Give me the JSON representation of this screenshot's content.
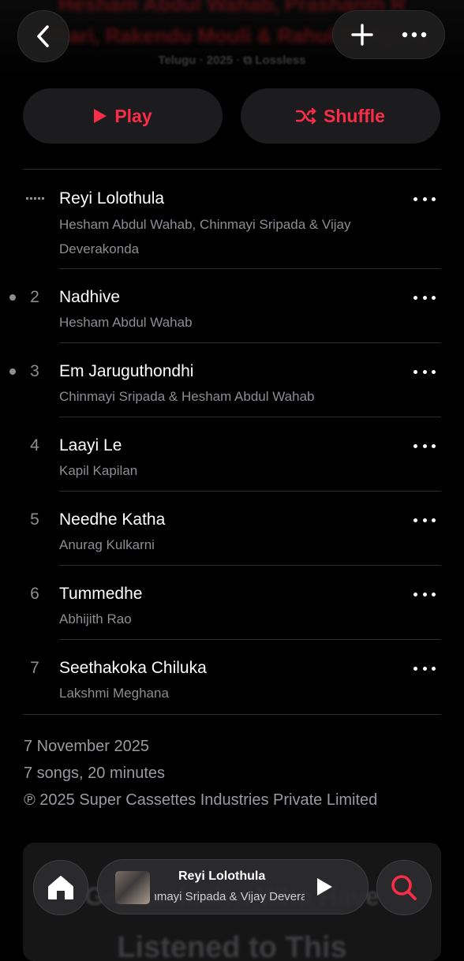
{
  "header": {
    "artists_line1": "Hesham Abdul Wahab, Prashanth R",
    "artists_line2": "Vihari, Rakendu Mouli & Rahul Sipligunj",
    "meta": "Telugu · 2025 · ⧉ Lossless",
    "back_icon": "chevron-left-icon",
    "add_icon": "plus-icon",
    "more_icon": "ellipsis-icon"
  },
  "actions": {
    "play_label": "Play",
    "shuffle_label": "Shuffle",
    "accent_color": "#fa2d48"
  },
  "tracks": [
    {
      "number": "",
      "title": "Reyi Lolothula",
      "artist": "Hesham Abdul Wahab, Chinmayi Sripada & Vijay Deverakonda",
      "playing": true,
      "downloaded": false
    },
    {
      "number": "2",
      "title": "Nadhive",
      "artist": "Hesham Abdul Wahab",
      "playing": false,
      "downloaded": true
    },
    {
      "number": "3",
      "title": "Em Jaruguthondhi",
      "artist": "Chinmayi Sripada & Hesham Abdul Wahab",
      "playing": false,
      "downloaded": true
    },
    {
      "number": "4",
      "title": "Laayi Le",
      "artist": "Kapil Kapilan",
      "playing": false,
      "downloaded": false
    },
    {
      "number": "5",
      "title": "Needhe Katha",
      "artist": "Anurag Kulkarni",
      "playing": false,
      "downloaded": false
    },
    {
      "number": "6",
      "title": "Tummedhe",
      "artist": "Abhijith Rao",
      "playing": false,
      "downloaded": false
    },
    {
      "number": "7",
      "title": "Seethakoka Chiluka",
      "artist": "Lakshmi Meghana",
      "playing": false,
      "downloaded": false
    }
  ],
  "album_info": {
    "release_date": "7 November 2025",
    "summary": "7 songs, 20 minutes",
    "copyright": "℗ 2025 Super Cassettes Industries Private Limited"
  },
  "promo_card": {
    "line1": "Get Exclusive Who Have",
    "line2": "Listened to This"
  },
  "tab_bar": {
    "home_icon": "home-icon",
    "search_icon": "search-icon"
  },
  "now_playing": {
    "title": "Reyi Lolothula",
    "subtitle": "Chinmayi Sripada & Vijay Deverakonda"
  }
}
